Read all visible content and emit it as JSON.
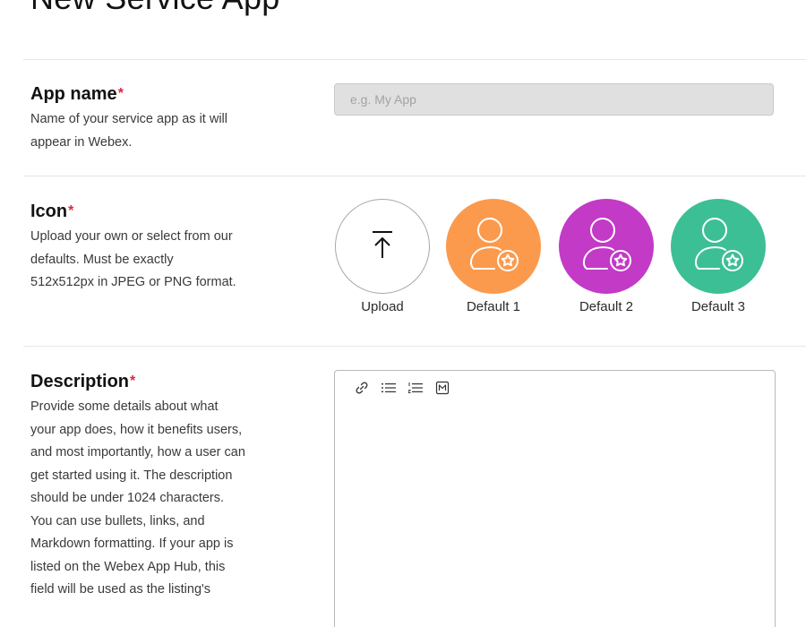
{
  "page": {
    "title": "New Service App"
  },
  "colors": {
    "required": "#e0273a",
    "default_1": "#fb9a4d",
    "default_2": "#c23ac6",
    "default_3": "#3dbf95"
  },
  "app_name": {
    "label": "App name",
    "required_mark": "*",
    "help": "Name of your service app as it will appear in Webex.",
    "placeholder": "e.g. My App",
    "value": ""
  },
  "icon": {
    "label": "Icon",
    "required_mark": "*",
    "help": "Upload your own or select from our defaults. Must be exactly 512x512px in JPEG or PNG format.",
    "options": [
      {
        "caption": "Upload",
        "icon": "upload-arrow-icon"
      },
      {
        "caption": "Default 1",
        "icon": "user-gear-icon"
      },
      {
        "caption": "Default 2",
        "icon": "user-gear-icon"
      },
      {
        "caption": "Default 3",
        "icon": "user-gear-icon"
      }
    ]
  },
  "description": {
    "label": "Description",
    "required_mark": "*",
    "help": "Provide some details about what your app does, how it benefits users, and most importantly, how a user can get started using it. The description should be under 1024 characters. You can use bullets, links, and Markdown formatting. If your app is listed on the Webex App Hub, this field will be used as the listing's",
    "toolbar": [
      "link-icon",
      "bulleted-list-icon",
      "numbered-list-icon",
      "markdown-icon"
    ],
    "value": ""
  }
}
